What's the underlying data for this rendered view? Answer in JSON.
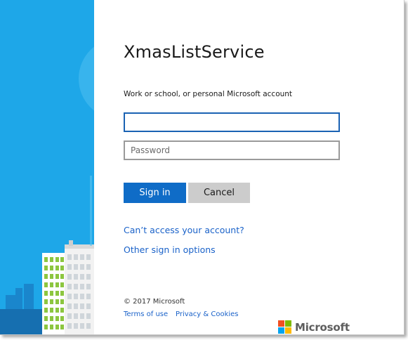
{
  "app": {
    "title": "XmasListService"
  },
  "form": {
    "account_label": "Work or school, or personal Microsoft account",
    "email": {
      "value": "",
      "placeholder": ""
    },
    "password": {
      "value": "",
      "placeholder": "Password"
    },
    "sign_in_label": "Sign in",
    "cancel_label": "Cancel"
  },
  "links": {
    "cant_access": "Can’t access your account?",
    "other_options": "Other sign in options"
  },
  "footer": {
    "copyright": "© 2017 Microsoft",
    "terms": "Terms of use",
    "privacy": "Privacy & Cookies",
    "brand": "Microsoft"
  },
  "colors": {
    "hero_blue": "#1ea7e8",
    "primary_button": "#0f6cc7",
    "link": "#1a62c9",
    "logo_red": "#f25022",
    "logo_green": "#7fba00",
    "logo_blue": "#00a4ef",
    "logo_yellow": "#ffb900"
  },
  "icons": {
    "hero": "city-illustration",
    "brand": "microsoft-logo-icon"
  }
}
